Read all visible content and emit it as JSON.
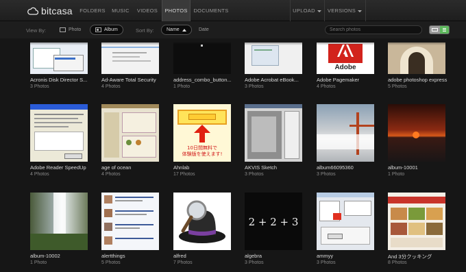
{
  "app": {
    "name": "bitcasa"
  },
  "nav": {
    "items": [
      "FOLDERS",
      "MUSIC",
      "VIDEOS",
      "PHOTOS",
      "DOCUMENTS"
    ],
    "active": "PHOTOS",
    "upload": "UPLOAD",
    "versions": "VERSIONS"
  },
  "toolbar": {
    "view_by_label": "View By:",
    "view_photo": "Photo",
    "view_album": "Album",
    "sort_by_label": "Sort By:",
    "sort_name": "Name",
    "sort_date": "Date",
    "search_placeholder": "Search photos",
    "accent_color": "#5db85c"
  },
  "albums": [
    {
      "name": "Acronis Disk Director S...",
      "count": "3 Photos"
    },
    {
      "name": "Ad-Aware Total Security",
      "count": "4 Photos"
    },
    {
      "name": "address_combo_button...",
      "count": "1 Photo"
    },
    {
      "name": "Adobe Acrobat eBook...",
      "count": "3 Photos"
    },
    {
      "name": "Adobe Pagemaker",
      "count": "4 Photos",
      "thumb_text": "Adobe"
    },
    {
      "name": "adobe photoshop express",
      "count": "5 Photos"
    },
    {
      "name": "Adobe Reader SpeedUp",
      "count": "4 Photos"
    },
    {
      "name": "age of ocean",
      "count": "4 Photos"
    },
    {
      "name": "Ahnlab",
      "count": "17 Photos",
      "thumb_text_1": "10日間無料で",
      "thumb_text_2": "体験版を使えます!"
    },
    {
      "name": "AKVIS Sketch",
      "count": "3 Photos"
    },
    {
      "name": "album66095360",
      "count": "3 Photos"
    },
    {
      "name": "album-10001",
      "count": "1 Photo"
    },
    {
      "name": "album-10002",
      "count": "1 Photo"
    },
    {
      "name": "alertthings",
      "count": "5 Photos"
    },
    {
      "name": "alfred",
      "count": "7 Photos"
    },
    {
      "name": "algebra",
      "count": "3 Photos",
      "thumb_text": "2 + 2 + 3"
    },
    {
      "name": "ammyy",
      "count": "3 Photos"
    },
    {
      "name": "And 3分クッキング",
      "count": "8 Photos"
    }
  ]
}
